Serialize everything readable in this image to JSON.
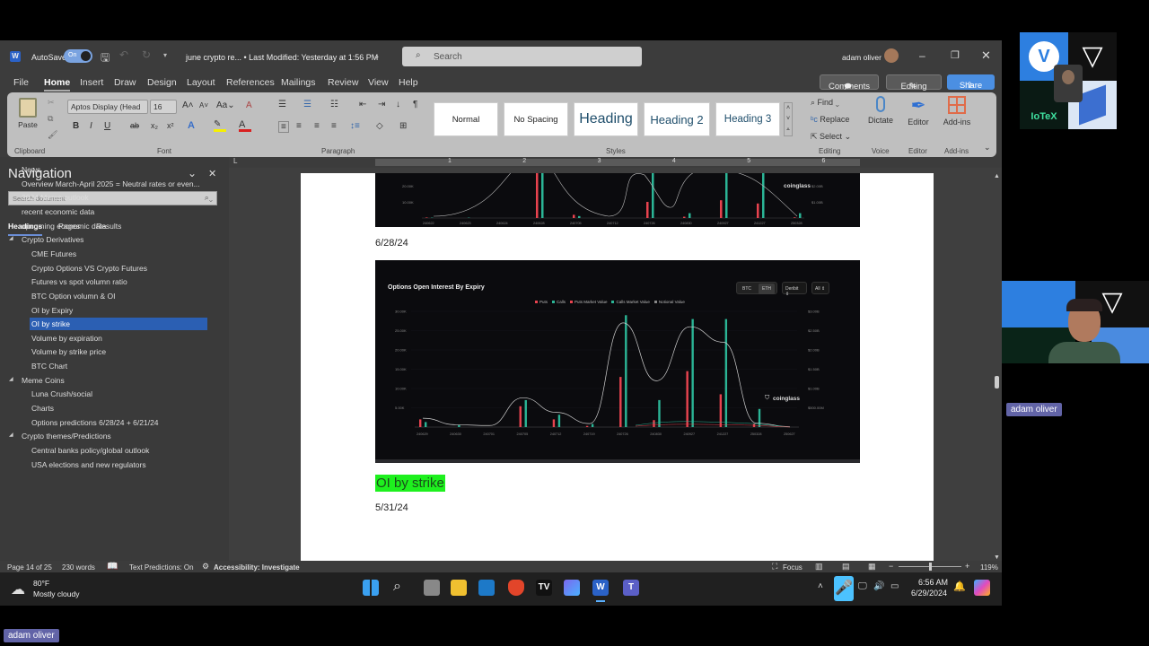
{
  "titlebar": {
    "autosave_label": "AutoSave",
    "autosave_state": "On",
    "doc_title": "june crypto re... • Last Modified: Yesterday at 1:56 PM",
    "search_placeholder": "Search",
    "user_name": "adam oliver"
  },
  "menu": {
    "tabs": [
      "File",
      "Home",
      "Insert",
      "Draw",
      "Design",
      "Layout",
      "References",
      "Mailings",
      "Review",
      "View",
      "Help"
    ],
    "active": "Home",
    "comments_label": "Comments",
    "editing_label": "Editing",
    "share_label": "Share"
  },
  "ribbon": {
    "clipboard": {
      "paste_label": "Paste",
      "group_label": "Clipboard"
    },
    "font": {
      "font_name": "Aptos Display (Head",
      "font_size": "16",
      "group_label": "Font",
      "highlight_color": "#f6f000",
      "font_color": "#d92020"
    },
    "paragraph": {
      "group_label": "Paragraph"
    },
    "styles": {
      "items": [
        "Normal",
        "No Spacing",
        "Heading",
        "Heading 2",
        "Heading 3"
      ],
      "group_label": "Styles"
    },
    "editing": {
      "find_label": "Find",
      "replace_label": "Replace",
      "select_label": "Select",
      "group_label": "Editing"
    },
    "voice": {
      "dictate_label": "Dictate",
      "group_label": "Voice"
    },
    "editor": {
      "editor_label": "Editor",
      "group_label": "Editor"
    },
    "addins": {
      "addins_label": "Add-ins",
      "group_label": "Add-ins"
    }
  },
  "navigation": {
    "title": "Navigation",
    "search_placeholder": "Search document",
    "tabs": [
      "Headings",
      "Pages",
      "Results"
    ],
    "active_tab": "Headings",
    "items": [
      {
        "label": "News",
        "level": 1
      },
      {
        "label": "Overview March-April 2025 = Neutral rates or even...",
        "level": 1
      },
      {
        "label": "2024 Marco outlook",
        "level": 1
      },
      {
        "label": "recent economic data",
        "level": 1
      },
      {
        "label": "upcoming economic data",
        "level": 1
      },
      {
        "label": "Crypto Derivatives",
        "level": 1,
        "expanded": true
      },
      {
        "label": "CME Futures",
        "level": 2
      },
      {
        "label": "Crypto Options VS Crypto Futures",
        "level": 2
      },
      {
        "label": "Futures vs spot volumn ratio",
        "level": 2
      },
      {
        "label": "BTC Option volumn & OI",
        "level": 2
      },
      {
        "label": "OI by Expiry",
        "level": 2
      },
      {
        "label": "OI by strike",
        "level": 2,
        "selected": true
      },
      {
        "label": "Volume by expiration",
        "level": 2
      },
      {
        "label": "Volume by strike price",
        "level": 2
      },
      {
        "label": "BTC Chart",
        "level": 2
      },
      {
        "label": "Meme Coins",
        "level": 1,
        "expanded": true
      },
      {
        "label": "Luna Crush/social",
        "level": 2
      },
      {
        "label": "Charts",
        "level": 2
      },
      {
        "label": "Options predictions 6/28/24 + 6/21/24",
        "level": 2
      },
      {
        "label": "Crypto themes/Predictions",
        "level": 1,
        "expanded": true
      },
      {
        "label": "Central banks policy/global outlook",
        "level": 2
      },
      {
        "label": "USA elections and new regulators",
        "level": 2
      }
    ]
  },
  "ruler": {
    "marks": [
      "1",
      "2",
      "3",
      "4",
      "5",
      "6"
    ]
  },
  "document": {
    "date_1": "6/28/24",
    "heading": "OI by strike",
    "heading_highlight": "#1ef01e",
    "date_2": "5/31/24"
  },
  "chart_data": [
    {
      "type": "bar",
      "title": "",
      "note": "partially visible chart (cropped top)",
      "categories": [
        "240622",
        "240623",
        "240624",
        "240628",
        "240705",
        "240712",
        "240726",
        "240830",
        "240927",
        "241227",
        "250328"
      ],
      "y_ticks_left": [
        "10.00K",
        "20.00K"
      ],
      "y_ticks_right": [
        "$1.00B",
        "$2.00B"
      ],
      "watermark": "coinglass",
      "series": [
        {
          "name": "Puts",
          "color": "#e8434f",
          "values": [
            300,
            0,
            0,
            30000,
            2000,
            0,
            10000,
            800,
            11000,
            9000,
            400
          ]
        },
        {
          "name": "Calls",
          "color": "#2bb596",
          "values": [
            200,
            200,
            0,
            30000,
            1200,
            0,
            30000,
            3000,
            30000,
            30000,
            3000
          ]
        }
      ]
    },
    {
      "type": "bar",
      "title": "Options Open Interest By Expiry",
      "controls": {
        "asset_options": [
          "BTC",
          "ETH"
        ],
        "asset_selected": "ETH",
        "exchange": "Deribit",
        "filter": "All"
      },
      "legend": [
        {
          "name": "Puts",
          "color": "#e8434f"
        },
        {
          "name": "Calls",
          "color": "#2bb596"
        },
        {
          "name": "Puts Market Value",
          "color": "#e8434f"
        },
        {
          "name": "Calls Market Value",
          "color": "#2bb596"
        },
        {
          "name": "Notional Value",
          "color": "#888888"
        }
      ],
      "legend_position": "top-center",
      "categories": [
        "240629",
        "240630",
        "240701",
        "240705",
        "240712",
        "240719",
        "240726",
        "240830",
        "240927",
        "241227",
        "250328",
        "250627"
      ],
      "y_ticks_left": [
        "5.00K",
        "10.00K",
        "15.00K",
        "20.00K",
        "25.00K",
        "30.00K"
      ],
      "ylim": [
        0,
        30000
      ],
      "y_ticks_right": [
        "$500.00M",
        "$1.00B",
        "$1.50B",
        "$2.00B",
        "$2.50B",
        "$3.00B"
      ],
      "y2lim": [
        0,
        3000000000
      ],
      "watermark": "coinglass",
      "series": [
        {
          "name": "Puts",
          "values": [
            2000,
            0,
            0,
            5400,
            2000,
            300,
            13000,
            1800,
            14500,
            8500,
            800,
            0
          ]
        },
        {
          "name": "Calls",
          "values": [
            1300,
            500,
            0,
            7000,
            3200,
            800,
            29000,
            7000,
            28000,
            28000,
            4700,
            0
          ]
        },
        {
          "name": "Notional Value",
          "type": "line",
          "values": [
            230000000,
            60000000,
            40000000,
            760000000,
            380000000,
            90000000,
            2700000000,
            1200000000,
            2600000000,
            2200000000,
            100000000,
            10000000
          ]
        }
      ]
    }
  ],
  "statusbar": {
    "page": "Page 14 of 25",
    "words": "230 words",
    "text_predictions": "Text Predictions: On",
    "accessibility": "Accessibility: Investigate",
    "focus": "Focus",
    "zoom": "119%"
  },
  "taskbar": {
    "weather_temp": "80°F",
    "weather_desc": "Mostly cloudy",
    "time": "6:56 AM",
    "date": "6/29/2024"
  },
  "video": {
    "participant_name": "adam oliver",
    "presenter_name": "adam oliver"
  }
}
